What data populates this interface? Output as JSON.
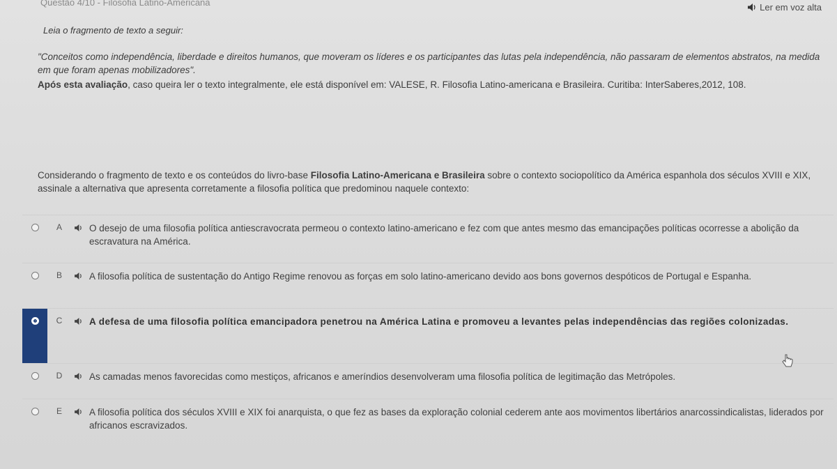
{
  "header": {
    "question_ref": "Questão 4/10 - Filosofia Latino-Americana",
    "tts_label": "Ler em voz alta"
  },
  "passage": {
    "prompt": "Leia o fragmento de texto a seguir:",
    "quote": "\"Conceitos como independência, liberdade e direitos humanos, que moveram os líderes e os participantes das lutas pela independência, não passaram de elementos abstratos, na medida em que foram apenas mobilizadores\".",
    "citation_bold": "Após esta avaliação",
    "citation_rest": ", caso queira ler o texto integralmente, ele está disponível em: VALESE, R. Filosofia Latino-americana e Brasileira. Curitiba: InterSaberes,2012, 108."
  },
  "stem": {
    "before": "Considerando o fragmento de texto e os conteúdos do livro-base ",
    "book_title": "Filosofia Latino-Americana e Brasileira",
    "after": " sobre o contexto sociopolítico da América espanhola dos séculos XVIII e XIX, assinale a alternativa que apresenta corretamente a filosofia política que predominou naquele contexto:"
  },
  "options": [
    {
      "letter": "A",
      "text": "O desejo de uma filosofia política antiescravocrata permeou o contexto latino-americano e fez com que antes mesmo das emancipações políticas ocorresse a abolição da escravatura na América.",
      "selected": false
    },
    {
      "letter": "B",
      "text": "A filosofia política de sustentação do Antigo Regime renovou as forças em solo latino-americano devido aos bons governos despóticos de Portugal e Espanha.",
      "selected": false
    },
    {
      "letter": "C",
      "text": "A defesa de uma filosofia política emancipadora penetrou na América Latina e promoveu a levantes pelas independências das regiões colonizadas.",
      "selected": true
    },
    {
      "letter": "D",
      "text": "As camadas menos favorecidas como mestiços, africanos e ameríndios desenvolveram uma filosofia política de legitimação das Metrópoles.",
      "selected": false
    },
    {
      "letter": "E",
      "text": "A filosofia política dos séculos XVIII e XIX foi anarquista, o que fez as bases da exploração colonial cederem ante aos movimentos libertários anarcossindicalistas, liderados por africanos escravizados.",
      "selected": false
    }
  ],
  "colors": {
    "selected_bar": "#1f3f7a",
    "background": "#dcdcdc"
  },
  "icons": {
    "tts": "speaker-icon",
    "pointer": "cursor-icon"
  }
}
